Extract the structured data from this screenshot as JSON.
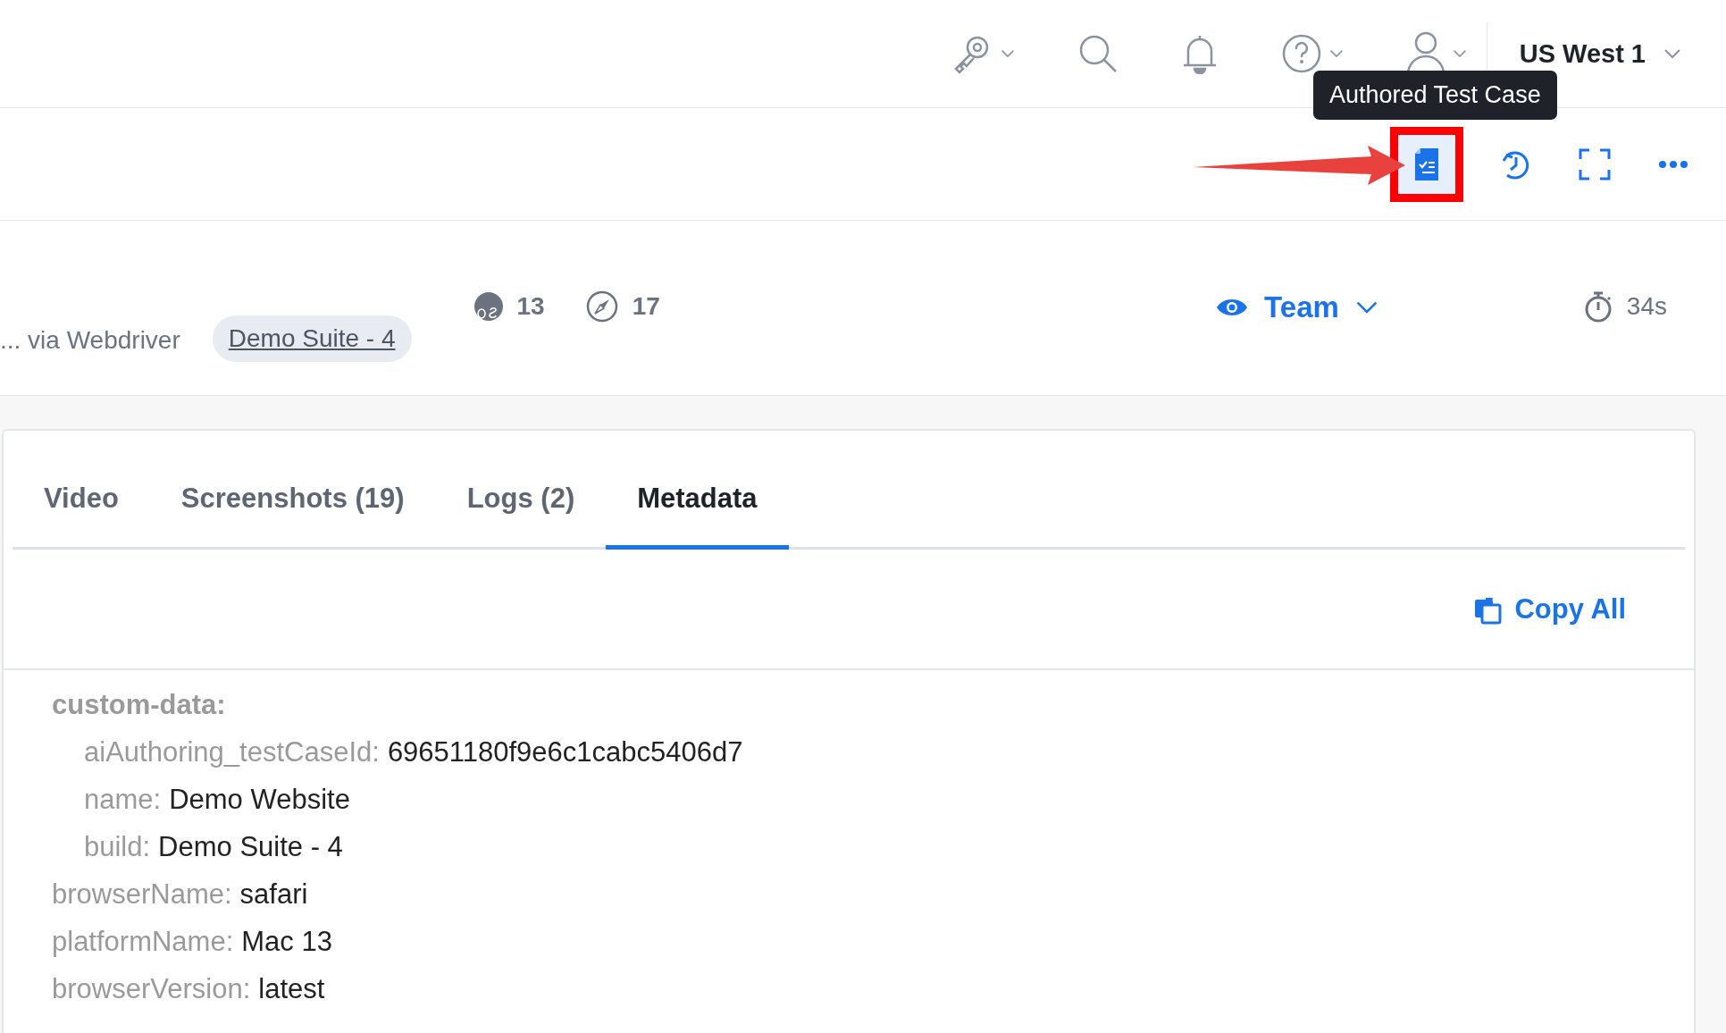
{
  "header": {
    "icons": [
      {
        "kind": "key",
        "dropdown": true
      },
      {
        "kind": "search",
        "dropdown": false
      },
      {
        "kind": "bell",
        "dropdown": false
      },
      {
        "kind": "help",
        "dropdown": true
      },
      {
        "kind": "user",
        "dropdown": true
      }
    ],
    "region": "US West 1"
  },
  "toolbar": {
    "tooltip": "Authored Test Case",
    "buttons": [
      {
        "kind": "testcase",
        "highlighted": true
      },
      {
        "kind": "history",
        "highlighted": false
      },
      {
        "kind": "fullscreen",
        "highlighted": false
      },
      {
        "kind": "more",
        "highlighted": false
      }
    ]
  },
  "info": {
    "runner": "... via Webdriver",
    "build": "Demo Suite - 4",
    "os_version": "13",
    "browser_version": "17",
    "visibility": "Team",
    "duration": "34s"
  },
  "tabs": [
    {
      "label": "Video",
      "selected": false
    },
    {
      "label": "Screenshots (19)",
      "selected": false
    },
    {
      "label": "Logs (2)",
      "selected": false
    },
    {
      "label": "Metadata",
      "selected": true
    }
  ],
  "copy_all": "Copy All",
  "metadata": [
    {
      "key": "custom-data:",
      "children": [
        {
          "key": "aiAuthoring_testCaseId:",
          "value": "69651180f9e6c1cabc5406d7"
        },
        {
          "key": "name:",
          "value": "Demo Website"
        },
        {
          "key": "build:",
          "value": "Demo Suite - 4"
        }
      ]
    },
    {
      "key": "browserName:",
      "value": "safari"
    },
    {
      "key": "platformName:",
      "value": "Mac 13"
    },
    {
      "key": "browserVersion:",
      "value": "latest"
    }
  ]
}
